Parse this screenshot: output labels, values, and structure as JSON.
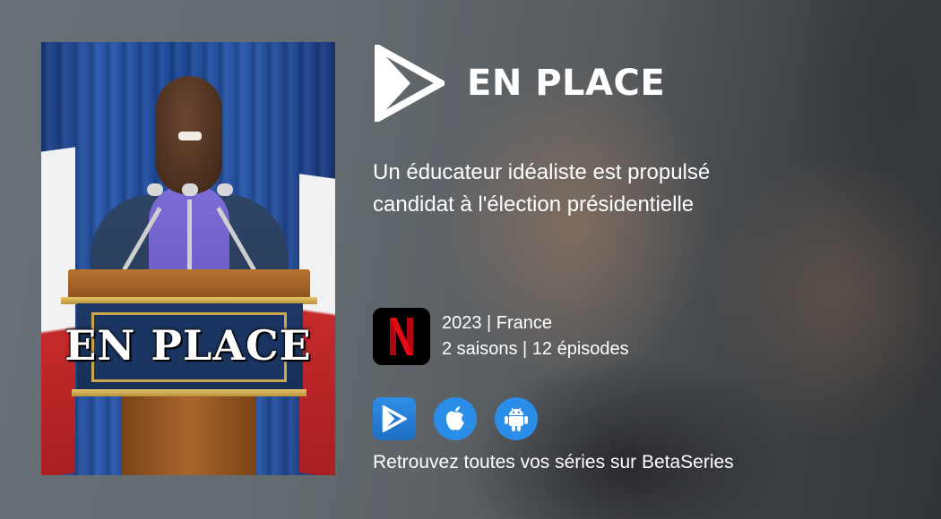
{
  "show": {
    "title": "EN PLACE",
    "tagline_line1": "Un éducateur idéaliste est propulsé",
    "tagline_line2": "candidat à l'élection présidentielle",
    "year_country": "2023 | France",
    "seasons_episodes": "2 saisons | 12 épisodes"
  },
  "poster": {
    "title": "EN PLACE"
  },
  "streaming": {
    "service_icon": "netflix-logo",
    "brand_color": "#E50914"
  },
  "apps": {
    "icons": [
      "betaseries-icon",
      "apple-icon",
      "android-icon"
    ],
    "accent_color": "#2a8ee8"
  },
  "footer": {
    "text": "Retrouvez toutes vos séries sur BetaSeries"
  }
}
